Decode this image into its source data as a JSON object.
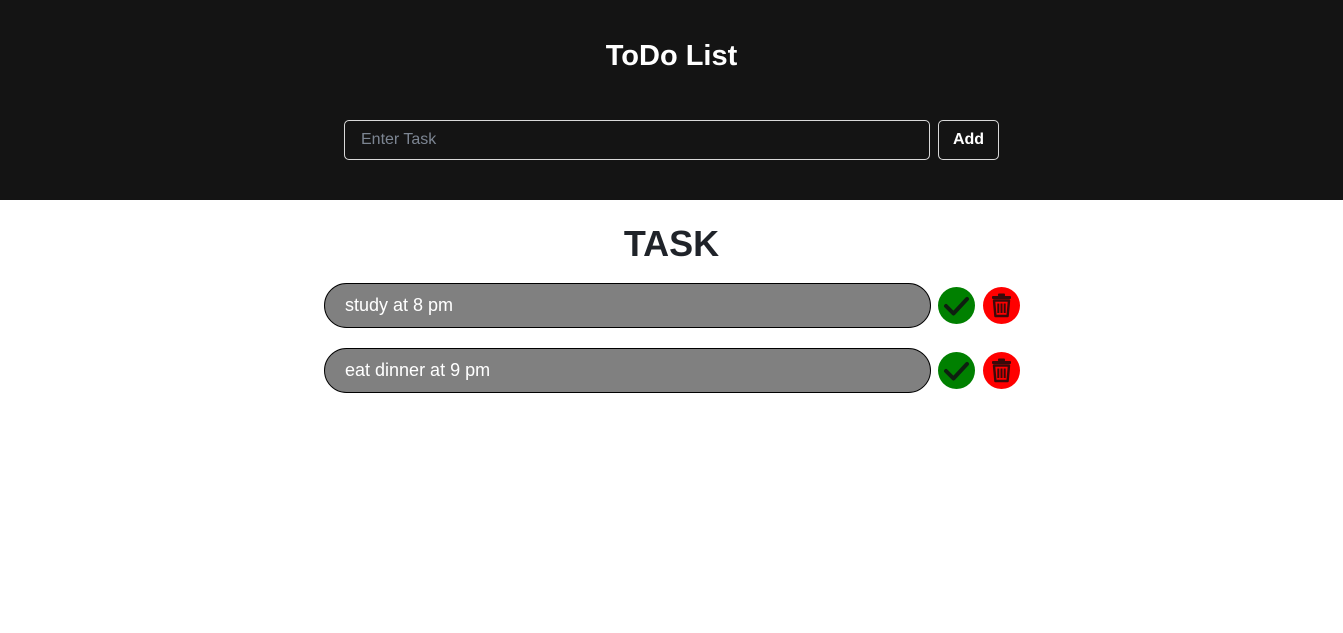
{
  "header": {
    "title": "ToDo List",
    "input_placeholder": "Enter Task",
    "input_value": "",
    "add_label": "Add"
  },
  "tasks_section": {
    "title": "TASK",
    "items": [
      {
        "text": "study at 8 pm",
        "complete_icon": "check-icon",
        "delete_icon": "trash-icon"
      },
      {
        "text": "eat dinner at 9 pm",
        "complete_icon": "check-icon",
        "delete_icon": "trash-icon"
      }
    ]
  },
  "colors": {
    "header_bg": "#141414",
    "task_pill_bg": "#808080",
    "complete_button": "#008000",
    "delete_button": "#ff0000"
  }
}
